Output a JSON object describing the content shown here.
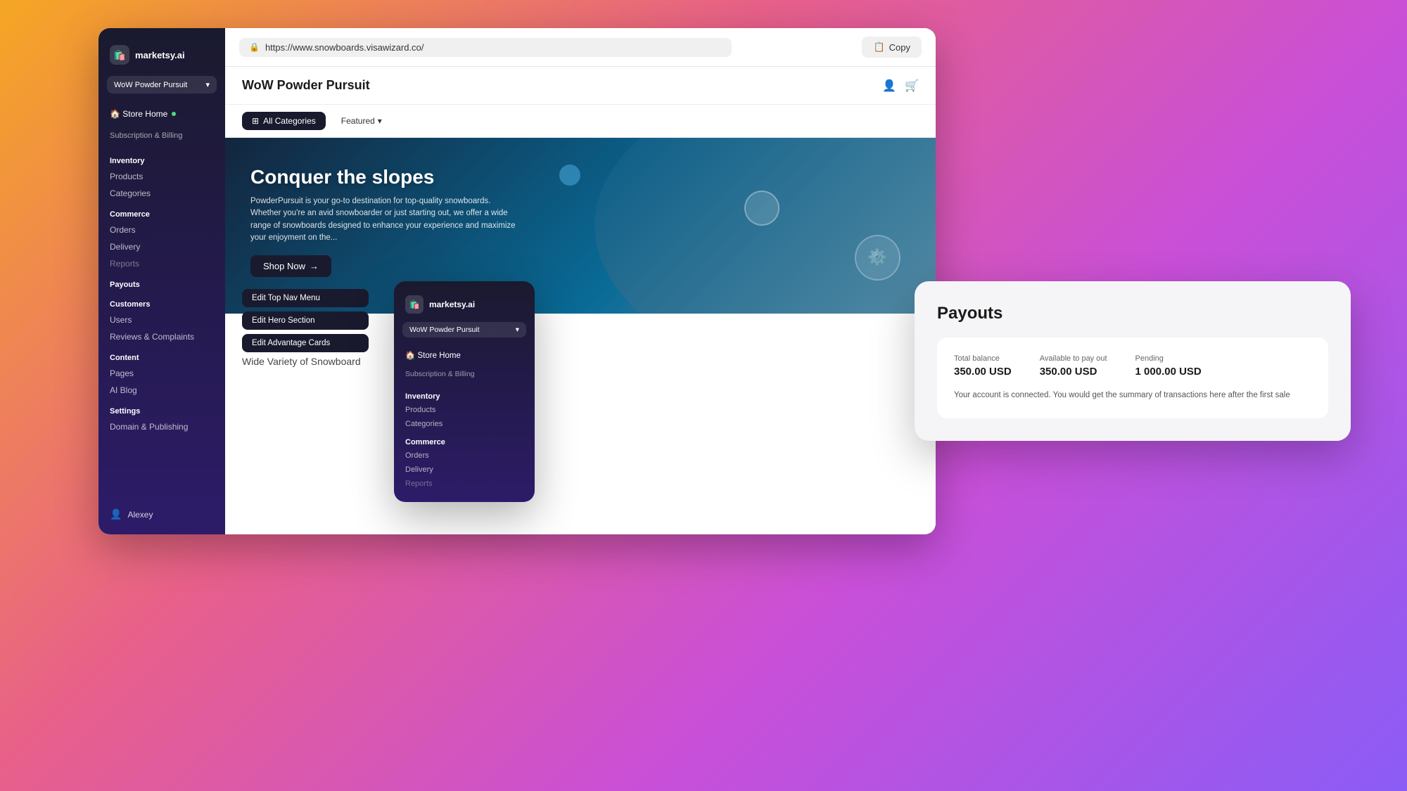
{
  "background": "linear-gradient(135deg, #f5a623, #e8608a, #c94fd8, #8b5cf6)",
  "url_bar": {
    "url": "https://www.snowboards.visawizard.co/",
    "copy_label": "Copy",
    "lock_icon": "🔒"
  },
  "sidebar": {
    "logo": "marketsy.ai",
    "store_selector": "WoW Powder Pursuit",
    "store_home": "🏠 Store Home",
    "subscription": "Subscription & Billing",
    "sections": [
      {
        "title": "Inventory",
        "links": [
          "Products",
          "Categories"
        ]
      },
      {
        "title": "Commerce",
        "links": [
          "Orders",
          "Delivery",
          "Reports"
        ]
      },
      {
        "title": "Payouts",
        "links": []
      },
      {
        "title": "Customers",
        "links": [
          "Users",
          "Reviews & Complaints"
        ]
      },
      {
        "title": "Content",
        "links": [
          "Pages",
          "AI Blog"
        ]
      },
      {
        "title": "Settings",
        "links": [
          "Domain & Publishing"
        ]
      }
    ],
    "user": "Alexey"
  },
  "store": {
    "title": "WoW Powder Pursuit",
    "nav": {
      "all_categories": "All Categories",
      "featured": "Featured"
    },
    "hero": {
      "title": "Conquer the slopes",
      "description": "PowderPursuit is your go-to destination for top-quality snowboards. Whether you're an avid snowboarder or just starting out, we offer a wide range of snowboards designed to enhance your experience and maximize your enjoyment on the...",
      "shop_btn": "Shop Now"
    },
    "edit_buttons": {
      "top_nav": "Edit Top Nav Menu",
      "hero": "Edit Hero Section",
      "advantage": "Edit Advantage Cards"
    },
    "below_hero": "Wide Variety of Snowboard"
  },
  "payout": {
    "title": "Payouts",
    "total_balance_label": "Total balance",
    "total_balance": "350.00 USD",
    "available_label": "Available to pay out",
    "available": "350.00 USD",
    "pending_label": "Pending",
    "pending": "1 000.00 USD",
    "note": "Your account is connected. You would get the summary of transactions here after the first sale"
  },
  "second_sidebar": {
    "logo": "marketsy.ai",
    "store_selector": "WoW Powder Pursuit",
    "store_home": "🏠 Store Home",
    "subscription": "Subscription & Billing",
    "sections": [
      {
        "title": "Inventory",
        "links": [
          "Products",
          "Categories"
        ]
      },
      {
        "title": "Commerce",
        "links": [
          "Orders",
          "Delivery",
          "Reports"
        ]
      }
    ]
  }
}
